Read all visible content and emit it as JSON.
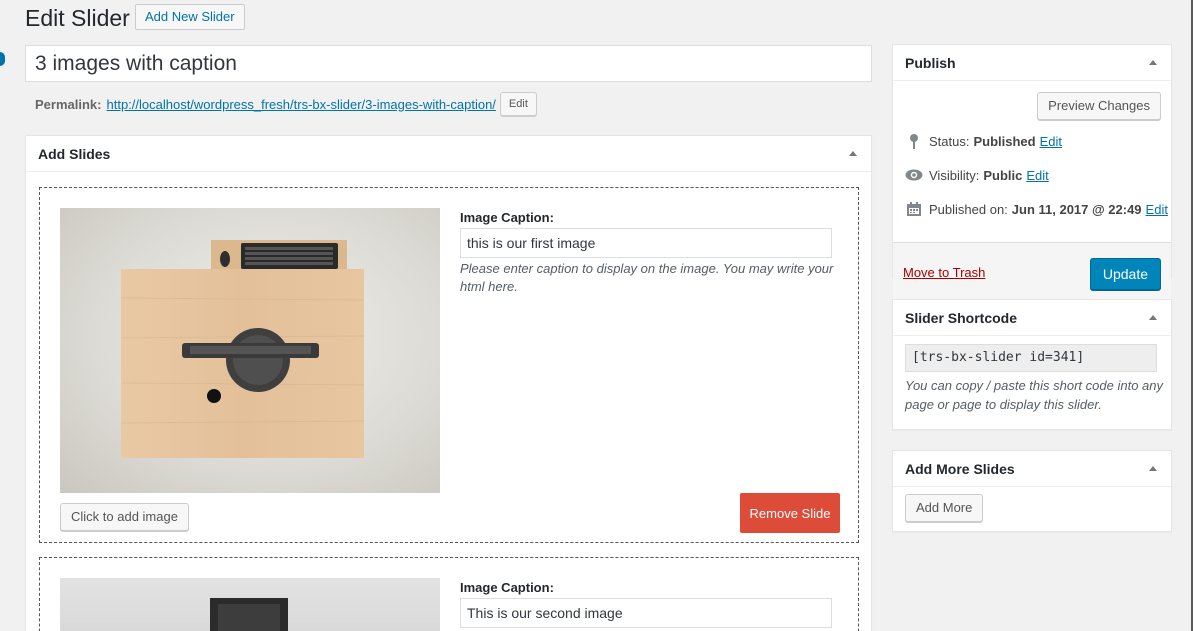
{
  "header": {
    "title": "Edit Slider",
    "add_new_label": "Add New Slider"
  },
  "post": {
    "title": "3 images with caption",
    "permalink_label": "Permalink:",
    "permalink_url": "http://localhost/wordpress_fresh/trs-bx-slider/3-images-with-caption/",
    "permalink_edit": "Edit"
  },
  "slides_box": {
    "title": "Add Slides",
    "slides": [
      {
        "caption_label": "Image Caption:",
        "caption_value": "this is our first image",
        "caption_help": "Please enter caption to display on the image. You may write your html here.",
        "add_image_label": "Click to add image",
        "remove_label": "Remove Slide"
      },
      {
        "caption_label": "Image Caption:",
        "caption_value": "This is our second image"
      }
    ]
  },
  "publish": {
    "title": "Publish",
    "preview_label": "Preview Changes",
    "status_label": "Status:",
    "status_value": "Published",
    "visibility_label": "Visibility:",
    "visibility_value": "Public",
    "published_label": "Published on:",
    "published_value": "Jun 11, 2017 @ 22:49",
    "edit_label": "Edit",
    "trash_label": "Move to Trash",
    "update_label": "Update"
  },
  "shortcode_box": {
    "title": "Slider Shortcode",
    "code": "[trs-bx-slider id=341]",
    "help": "You can copy / paste this short code into any page or page to display this slider."
  },
  "more_slides_box": {
    "title": "Add More Slides",
    "button_label": "Add More"
  },
  "colors": {
    "accent": "#0073aa",
    "primary": "#0085ba",
    "danger": "#dd4b39",
    "trash": "#a00"
  }
}
